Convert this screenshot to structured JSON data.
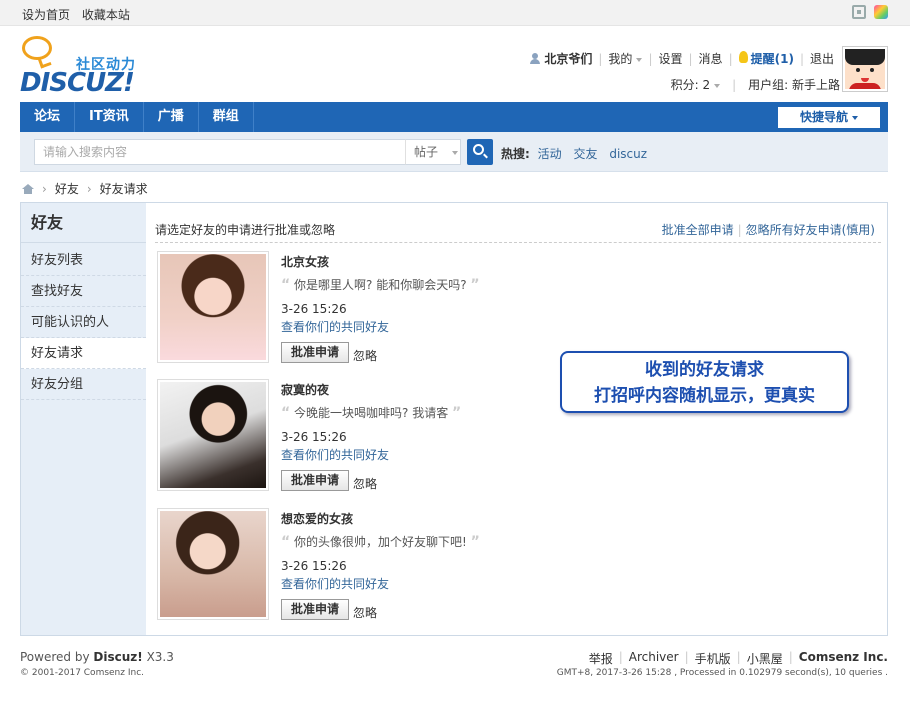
{
  "topbar": {
    "set_home": "设为首页",
    "bookmark": "收藏本站"
  },
  "logo": {
    "slogan": "社区动力",
    "brand": "DISCUZ!"
  },
  "user": {
    "name": "北京爷们",
    "my": "我的",
    "settings": "设置",
    "messages": "消息",
    "remind": "提醒(1)",
    "logout": "退出",
    "points": "积分: 2",
    "usergroup": "用户组: 新手上路"
  },
  "nav": {
    "items": [
      "论坛",
      "IT资讯",
      "广播",
      "群组"
    ],
    "quick": "快捷导航"
  },
  "search": {
    "placeholder": "请输入搜索内容",
    "type": "帖子",
    "hot_label": "热搜:",
    "hot": [
      "活动",
      "交友",
      "discuz"
    ]
  },
  "breadcrumb": [
    "好友",
    "好友请求"
  ],
  "sidebar": {
    "title": "好友",
    "items": [
      "好友列表",
      "查找好友",
      "可能认识的人",
      "好友请求",
      "好友分组"
    ]
  },
  "content": {
    "instruction": "请选定好友的申请进行批准或忽略",
    "approve_all": "批准全部申请",
    "ignore_all": "忽略所有好友申请(慎用)",
    "requests": [
      {
        "name": "北京女孩",
        "message": "你是哪里人啊? 能和你聊会天吗?",
        "time": "3-26 15:26",
        "common": "查看你们的共同好友",
        "approve": "批准申请",
        "ignore": "忽略"
      },
      {
        "name": "寂寞的夜",
        "message": "今晚能一块喝咖啡吗? 我请客",
        "time": "3-26 15:26",
        "common": "查看你们的共同好友",
        "approve": "批准申请",
        "ignore": "忽略"
      },
      {
        "name": "想恋爱的女孩",
        "message": "你的头像很帅，加个好友聊下吧!",
        "time": "3-26 15:26",
        "common": "查看你们的共同好友",
        "approve": "批准申请",
        "ignore": "忽略"
      }
    ]
  },
  "callout": {
    "line1": "收到的好友请求",
    "line2": "打招呼内容随机显示，更真实"
  },
  "footer": {
    "powered": "Powered by",
    "product": "Discuz!",
    "version": "X3.3",
    "copyright": "© 2001-2017 Comsenz Inc.",
    "links": [
      "举报",
      "Archiver",
      "手机版",
      "小黑屋"
    ],
    "company": "Comsenz Inc.",
    "stats": "GMT+8, 2017-3-26 15:28 , Processed in 0.102979 second(s), 10 queries ."
  },
  "colors": {
    "nav": "#1f66b5",
    "link": "#336699",
    "callout": "#1d4fb0",
    "sidebar": "#e6eef7"
  }
}
